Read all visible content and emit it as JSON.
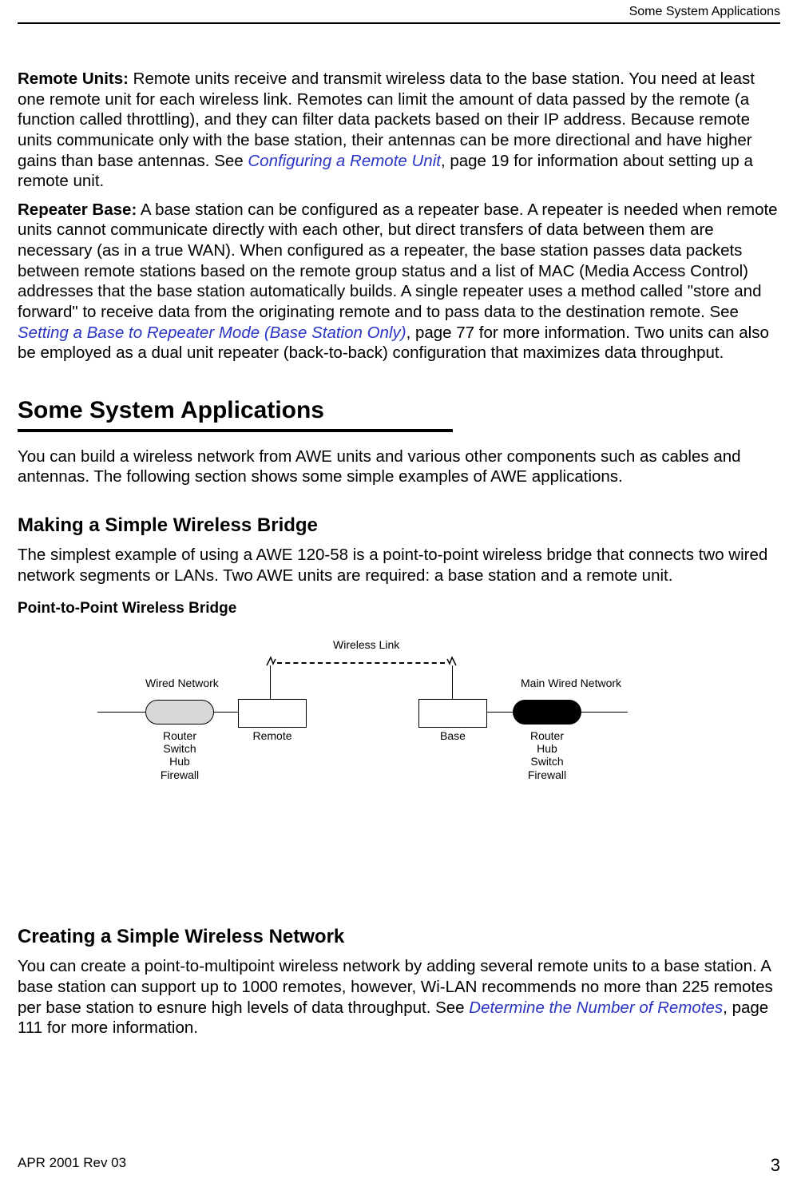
{
  "running_head": "Some System Applications",
  "remote_units": {
    "label": "Remote Units:",
    "pre": " Remote units receive and transmit wireless data to the base station. You need at least one remote unit for each wireless link. Remotes can limit the amount of data passed by the remote (a function called throttling), and they can filter data packets based on their IP address. Because remote units communicate only with the base station, their antennas can be more directional and have higher gains than base antennas. See ",
    "link": "Configuring a Remote Unit",
    "post": ", page 19 for information about setting up a remote unit."
  },
  "repeater_base": {
    "label": "Repeater Base:",
    "pre": " A base station can be configured as a repeater base. A repeater is needed when remote units cannot communicate directly with each other, but direct transfers of data between them are necessary (as in a true WAN). When configured as a repeater, the base station passes data packets between remote stations based on the remote group status and a list of MAC (Media Access Control) addresses that the base station automatically builds. A single repeater uses a method called \"store and forward\" to receive data from the originating remote and to pass data to the destination remote. See ",
    "link": "Setting a Base to Repeater Mode (Base Station Only)",
    "post": ", page 77 for more information. Two units can also be employed as a dual unit repeater (back-to-back) configuration that maximizes data throughput."
  },
  "section_title": "Some System Applications",
  "section_intro": "You can build a wireless network from AWE units and various other components such as cables and antennas. The following section shows some simple examples of AWE applications.",
  "bridge": {
    "heading": "Making a Simple Wireless Bridge",
    "body": "The simplest example of using a AWE 120-58 is a point-to-point wireless bridge that connects two wired network segments or LANs. Two AWE units are required: a base station and a remote unit.",
    "fig_title": "Point-to-Point Wireless Bridge"
  },
  "diagram": {
    "wireless_link": "Wireless Link",
    "wired_network": "Wired Network",
    "main_wired_network": "Main Wired Network",
    "remote": "Remote",
    "base": "Base",
    "left_router": "Router\nSwitch\nHub\nFirewall",
    "right_router": "Router\nHub\nSwitch\nFirewall"
  },
  "network": {
    "heading": "Creating a Simple Wireless Network",
    "pre": "You can create a point-to-multipoint wireless network by adding several remote units to a base station. A base station can support up to 1000 remotes, however, Wi-LAN recommends no more than 225 remotes per base station to esnure high levels of data throughput. See ",
    "link": "Determine the Number of Remotes",
    "post": ", page 111 for more information."
  },
  "footer": {
    "left": "APR 2001 Rev 03",
    "page": "3"
  }
}
